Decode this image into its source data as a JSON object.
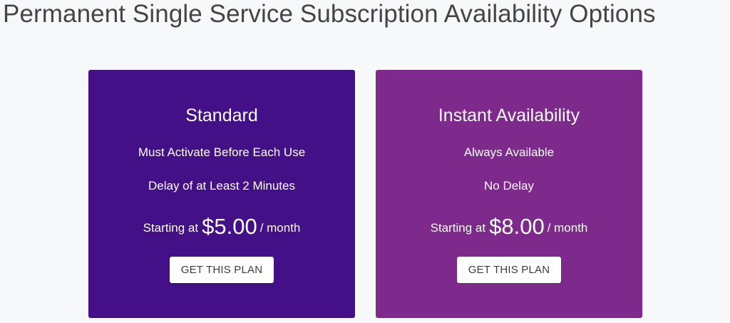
{
  "page": {
    "title": "Permanent Single Service Subscription Availability Options"
  },
  "colors": {
    "background": "#f7f8fa",
    "standard_card": "#431088",
    "instant_card": "#7e2a8c",
    "button_bg": "#ffffff",
    "title_text": "#454545"
  },
  "plans": [
    {
      "name": "Standard",
      "features": [
        "Must Activate Before Each Use",
        "Delay of at Least 2 Minutes"
      ],
      "price_prefix": "Starting at",
      "price": "$5.00",
      "price_suffix": "/ month",
      "button_label": "GET THIS PLAN"
    },
    {
      "name": "Instant Availability",
      "features": [
        "Always Available",
        "No Delay"
      ],
      "price_prefix": "Starting at",
      "price": "$8.00",
      "price_suffix": "/ month",
      "button_label": "GET THIS PLAN"
    }
  ]
}
